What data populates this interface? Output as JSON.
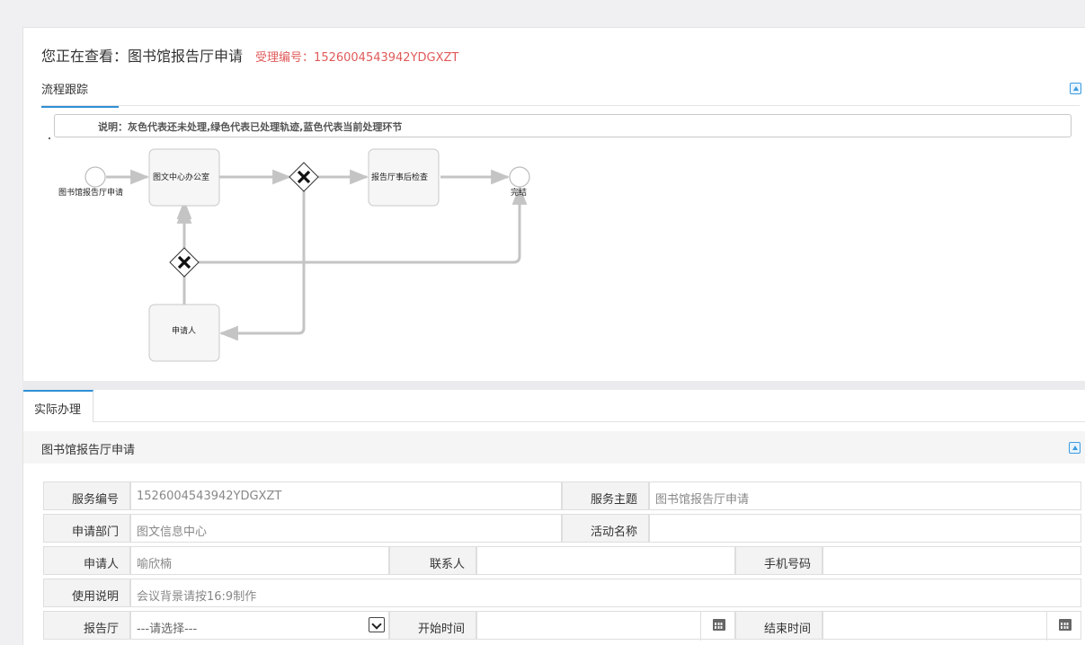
{
  "header": {
    "viewing_label": "您正在查看：",
    "viewing_title": "图书馆报告厅申请",
    "acceptance_label": "受理编号：",
    "acceptance_number": "1526004543942YDGXZT"
  },
  "flow_tab": {
    "label": "流程跟踪",
    "legend": "说明：灰色代表还未处理,绿色代表已处理轨迹,蓝色代表当前处理环节"
  },
  "flow": {
    "start_label": "图书馆报告厅申请",
    "task_center_office": "图文中心办公室",
    "task_hall_check": "报告厅事后检查",
    "end_label": "完结",
    "task_applicant": "申请人"
  },
  "actual_tab": {
    "label": "实际办理"
  },
  "section": {
    "title": "图书馆报告厅申请"
  },
  "form": {
    "service_no_label": "服务编号",
    "service_no_value": "1526004543942YDGXZT",
    "service_topic_label": "服务主题",
    "service_topic_value": "图书馆报告厅申请",
    "dept_label": "申请部门",
    "dept_value": "图文信息中心",
    "activity_label": "活动名称",
    "activity_value": "",
    "applicant_label": "申请人",
    "applicant_value": "喻欣楠",
    "contact_label": "联系人",
    "contact_value": "",
    "phone_label": "手机号码",
    "phone_value": "",
    "usage_label": "使用说明",
    "usage_value": "会议背景请按16:9制作",
    "hall_label": "报告厅",
    "hall_value": "---请选择---",
    "start_time_label": "开始时间",
    "start_time_value": "",
    "end_time_label": "结束时间",
    "end_time_value": ""
  },
  "colors": {
    "accent": "#2e8fd6",
    "acceptance_red": "#e05a5a"
  }
}
